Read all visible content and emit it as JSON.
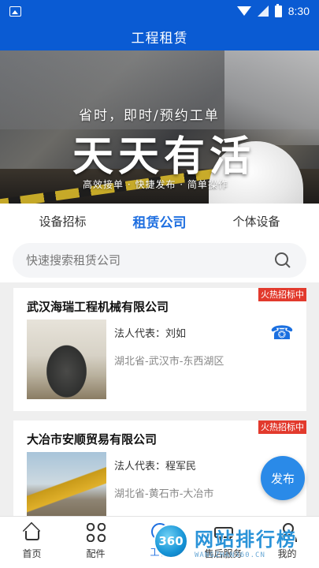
{
  "status_bar": {
    "time": "8:30",
    "icons": [
      "gallery-icon",
      "wifi-icon",
      "no-signal-icon",
      "battery-icon"
    ]
  },
  "header": {
    "title": "工程租赁"
  },
  "banner": {
    "subtitle": "省时，即时/预约工单",
    "headline": "天天有活",
    "tagline": "高效接单 · 快捷发布 · 简单操作"
  },
  "tabs": [
    {
      "label": "设备招标",
      "active": false
    },
    {
      "label": "租赁公司",
      "active": true
    },
    {
      "label": "个体设备",
      "active": false
    }
  ],
  "search": {
    "placeholder": "快速搜索租赁公司"
  },
  "companies": [
    {
      "name": "武汉海瑞工程机械有限公司",
      "badge": "火热招标中",
      "rep": "法人代表：刘如",
      "location": "湖北省-武汉市-东西湖区"
    },
    {
      "name": "大冶市安顺贸易有限公司",
      "badge": "火热招标中",
      "rep": "法人代表：程军民",
      "location": "湖北省-黄石市-大冶市"
    }
  ],
  "fab": {
    "label": "发布"
  },
  "bottom_nav": [
    {
      "label": "首页",
      "icon": "home-icon",
      "active": false
    },
    {
      "label": "配件",
      "icon": "grid-icon",
      "active": false
    },
    {
      "label": "工程",
      "icon": "lease-icon",
      "active": true
    },
    {
      "label": "售后服务",
      "icon": "truck-icon",
      "active": false
    },
    {
      "label": "我的",
      "icon": "user-icon",
      "active": false
    }
  ],
  "watermark": {
    "logo": "360",
    "text": "网站排行榜",
    "sub": "WANGZHAN360.CN"
  },
  "colors": {
    "primary": "#0a5bd3",
    "accent": "#1f6fe0",
    "badge": "#e23a2d",
    "fab": "#2a8ae8"
  }
}
